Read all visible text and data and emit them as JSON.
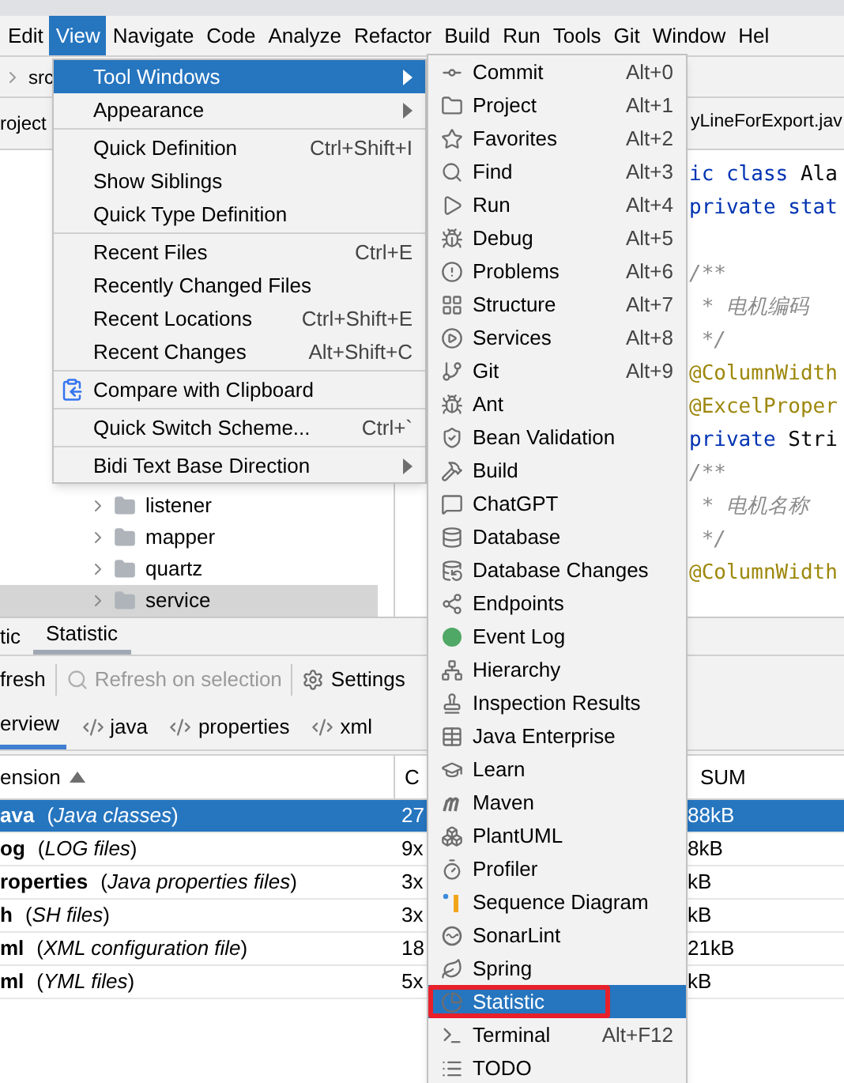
{
  "menu_bar": [
    {
      "label": "Edit",
      "selected": false
    },
    {
      "label": "View",
      "selected": true
    },
    {
      "label": "Navigate",
      "selected": false
    },
    {
      "label": "Code",
      "selected": false
    },
    {
      "label": "Analyze",
      "selected": false
    },
    {
      "label": "Refactor",
      "selected": false
    },
    {
      "label": "Build",
      "selected": false
    },
    {
      "label": "Run",
      "selected": false
    },
    {
      "label": "Tools",
      "selected": false
    },
    {
      "label": "Git",
      "selected": false
    },
    {
      "label": "Window",
      "selected": false
    },
    {
      "label": "Hel",
      "selected": false
    }
  ],
  "breadcrumb": "src",
  "project_panel": {
    "title": "roject",
    "tree": [
      {
        "label": "listener",
        "expanded": false,
        "selected": false
      },
      {
        "label": "mapper",
        "expanded": false,
        "selected": false
      },
      {
        "label": "quartz",
        "expanded": false,
        "selected": false
      },
      {
        "label": "service",
        "expanded": false,
        "selected": true
      }
    ]
  },
  "editor": {
    "tab": "yLineForExport.jav",
    "lines": [
      {
        "kind": "code",
        "tokens": [
          {
            "text": "ic class ",
            "kind": "keyword"
          },
          {
            "text": "Ala",
            "kind": "plain"
          }
        ]
      },
      {
        "kind": "code",
        "tokens": [
          {
            "text": "private stat",
            "kind": "keyword"
          }
        ]
      },
      {
        "kind": "blank"
      },
      {
        "kind": "code",
        "tokens": [
          {
            "text": "/**",
            "kind": "comment"
          }
        ]
      },
      {
        "kind": "code",
        "tokens": [
          {
            "text": " * 电机编码",
            "kind": "comment"
          }
        ]
      },
      {
        "kind": "code",
        "tokens": [
          {
            "text": " */",
            "kind": "comment"
          }
        ]
      },
      {
        "kind": "code",
        "tokens": [
          {
            "text": "@ColumnWidth",
            "kind": "annotation"
          }
        ]
      },
      {
        "kind": "code",
        "tokens": [
          {
            "text": "@ExcelProper",
            "kind": "annotation"
          }
        ]
      },
      {
        "kind": "code",
        "tokens": [
          {
            "text": "private ",
            "kind": "keyword"
          },
          {
            "text": "Stri",
            "kind": "plain"
          }
        ]
      },
      {
        "kind": "code",
        "tokens": [
          {
            "text": "/**",
            "kind": "comment"
          }
        ]
      },
      {
        "kind": "code",
        "tokens": [
          {
            "text": " * 电机名称",
            "kind": "comment"
          }
        ]
      },
      {
        "kind": "code",
        "tokens": [
          {
            "text": " */",
            "kind": "comment"
          }
        ]
      },
      {
        "kind": "code",
        "tokens": [
          {
            "text": "@ColumnWidth",
            "kind": "annotation"
          }
        ]
      }
    ]
  },
  "bottom_panel": {
    "tabs": [
      {
        "label": "tic",
        "selected": false
      },
      {
        "label": "Statistic",
        "selected": true
      }
    ],
    "toolbar": [
      {
        "label": "fresh",
        "disabled": false
      },
      {
        "label": "Refresh on selection",
        "disabled": true
      },
      {
        "label": "Settings",
        "disabled": false
      }
    ],
    "subtabs": [
      {
        "label": "erview",
        "kind": "overview",
        "selected": true
      },
      {
        "label": "java",
        "kind": "file_type",
        "selected": false
      },
      {
        "label": "properties",
        "kind": "file_type",
        "selected": false
      },
      {
        "label": "xml",
        "kind": "file_type",
        "selected": false
      }
    ],
    "table": {
      "columns": [
        "ension",
        "C",
        "SUM"
      ],
      "rows": [
        {
          "name": "ava",
          "description": "(*Java classes*)",
          "count": "27",
          "size": "88kB",
          "selected": true
        },
        {
          "name": "og",
          "description": "(*LOG files*)",
          "count": "9x",
          "size": "8kB",
          "selected": false
        },
        {
          "name": "roperties",
          "description": "(*Java properties files*)",
          "count": "3x",
          "size": "kB",
          "selected": false
        },
        {
          "name": "h",
          "description": "(*SH files*)",
          "count": "3x",
          "size": "kB",
          "selected": false
        },
        {
          "name": "ml",
          "description": "(*XML configuration file*)",
          "count": "18",
          "size": "21kB",
          "selected": false
        },
        {
          "name": "ml",
          "description": "(*YML files*)",
          "count": "5x",
          "size": "kB",
          "selected": false
        }
      ]
    }
  },
  "view_menu": {
    "items": [
      {
        "kind": "item",
        "label": "Tool Windows",
        "submenu": true,
        "selected": true
      },
      {
        "kind": "item",
        "label": "Appearance",
        "submenu": true,
        "selected": false
      },
      {
        "kind": "separator"
      },
      {
        "kind": "item",
        "label": "Quick Definition",
        "shortcut": "Ctrl+Shift+I",
        "submenu": false,
        "selected": false
      },
      {
        "kind": "item",
        "label": "Show Siblings",
        "submenu": false,
        "selected": false
      },
      {
        "kind": "item",
        "label": "Quick Type Definition",
        "submenu": false,
        "selected": false
      },
      {
        "kind": "separator"
      },
      {
        "kind": "item",
        "label": "Recent Files",
        "shortcut": "Ctrl+E",
        "submenu": false,
        "selected": false
      },
      {
        "kind": "item",
        "label": "Recently Changed Files",
        "submenu": false,
        "selected": false
      },
      {
        "kind": "item",
        "label": "Recent Locations",
        "shortcut": "Ctrl+Shift+E",
        "submenu": false,
        "selected": false
      },
      {
        "kind": "item",
        "label": "Recent Changes",
        "shortcut": "Alt+Shift+C",
        "submenu": false,
        "selected": false
      },
      {
        "kind": "separator"
      },
      {
        "kind": "icon_item",
        "label": "Compare with Clipboard",
        "submenu": false,
        "selected": false
      },
      {
        "kind": "separator"
      },
      {
        "kind": "item",
        "label": "Quick Switch Scheme...",
        "shortcut": "Ctrl+`",
        "submenu": false,
        "selected": false
      },
      {
        "kind": "separator"
      },
      {
        "kind": "item",
        "label": "Bidi Text Base Direction",
        "submenu": true,
        "selected": false
      }
    ]
  },
  "tool_windows_menu": {
    "items": [
      {
        "label": "Commit",
        "shortcut": "Alt+0",
        "selected": false,
        "boxed": false
      },
      {
        "label": "Project",
        "shortcut": "Alt+1",
        "selected": false,
        "boxed": false
      },
      {
        "label": "Favorites",
        "shortcut": "Alt+2",
        "selected": false,
        "boxed": false
      },
      {
        "label": "Find",
        "shortcut": "Alt+3",
        "selected": false,
        "boxed": false
      },
      {
        "label": "Run",
        "shortcut": "Alt+4",
        "selected": false,
        "boxed": false
      },
      {
        "label": "Debug",
        "shortcut": "Alt+5",
        "selected": false,
        "boxed": false
      },
      {
        "label": "Problems",
        "shortcut": "Alt+6",
        "selected": false,
        "boxed": false
      },
      {
        "label": "Structure",
        "shortcut": "Alt+7",
        "selected": false,
        "boxed": false
      },
      {
        "label": "Services",
        "shortcut": "Alt+8",
        "selected": false,
        "boxed": false
      },
      {
        "label": "Git",
        "shortcut": "Alt+9",
        "selected": false,
        "boxed": false
      },
      {
        "label": "Ant",
        "selected": false,
        "boxed": false
      },
      {
        "label": "Bean Validation",
        "selected": false,
        "boxed": false
      },
      {
        "label": "Build",
        "selected": false,
        "boxed": false
      },
      {
        "label": "ChatGPT",
        "selected": false,
        "boxed": false
      },
      {
        "label": "Database",
        "selected": false,
        "boxed": false
      },
      {
        "label": "Database Changes",
        "selected": false,
        "boxed": false
      },
      {
        "label": "Endpoints",
        "selected": false,
        "boxed": false
      },
      {
        "label": "Event Log",
        "selected": false,
        "boxed": false
      },
      {
        "label": "Hierarchy",
        "selected": false,
        "boxed": false
      },
      {
        "label": "Inspection Results",
        "selected": false,
        "boxed": false
      },
      {
        "label": "Java Enterprise",
        "selected": false,
        "boxed": false
      },
      {
        "label": "Learn",
        "selected": false,
        "boxed": false
      },
      {
        "label": "Maven",
        "selected": false,
        "boxed": false
      },
      {
        "label": "PlantUML",
        "selected": false,
        "boxed": false
      },
      {
        "label": "Profiler",
        "selected": false,
        "boxed": false
      },
      {
        "label": "Sequence Diagram",
        "selected": false,
        "boxed": false
      },
      {
        "label": "SonarLint",
        "selected": false,
        "boxed": false
      },
      {
        "label": "Spring",
        "selected": false,
        "boxed": false
      },
      {
        "label": "Statistic",
        "selected": true,
        "boxed": true
      },
      {
        "label": "Terminal",
        "shortcut": "Alt+F12",
        "selected": false,
        "boxed": false
      },
      {
        "label": "TODO",
        "selected": false,
        "boxed": false
      }
    ]
  }
}
